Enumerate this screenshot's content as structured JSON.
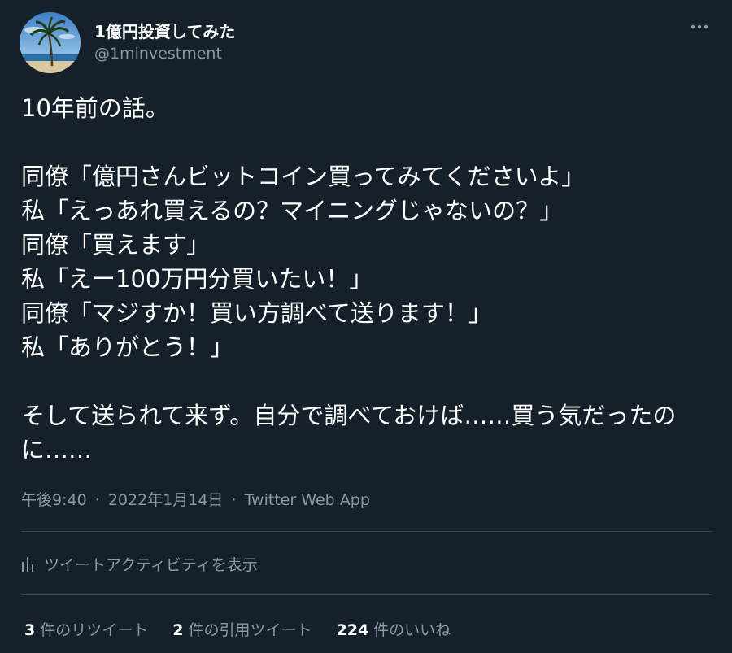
{
  "author": {
    "display_name": "1億円投資してみた",
    "handle": "@1minvestment",
    "avatar_icon": "palm-tree-avatar"
  },
  "more_icon": "more-horizontal-icon",
  "tweet": {
    "text": "10年前の話。\n\n同僚「億円さんビットコイン買ってみてくださいよ」\n私「えっあれ買えるの？マイニングじゃないの？」\n同僚「買えます」\n私「えー100万円分買いたい！」\n同僚「マジすか！買い方調べて送ります！」\n私「ありがとう！」\n\nそして送られて来ず。自分で調べておけば……買う気だったのに……",
    "time": "午後9:40",
    "date": "2022年1月14日",
    "separator": "·",
    "source": "Twitter Web App"
  },
  "activity": {
    "icon": "analytics-bars-icon",
    "label": "ツイートアクティビティを表示"
  },
  "stats": {
    "retweets": {
      "count": "3",
      "label": "件のリツイート"
    },
    "quotes": {
      "count": "2",
      "label": "件の引用ツイート"
    },
    "likes": {
      "count": "224",
      "label": "件のいいね"
    }
  },
  "colors": {
    "background": "#15202b",
    "primary_text": "#ffffff",
    "secondary_text": "#8b98a5",
    "divider": "#38444d"
  }
}
